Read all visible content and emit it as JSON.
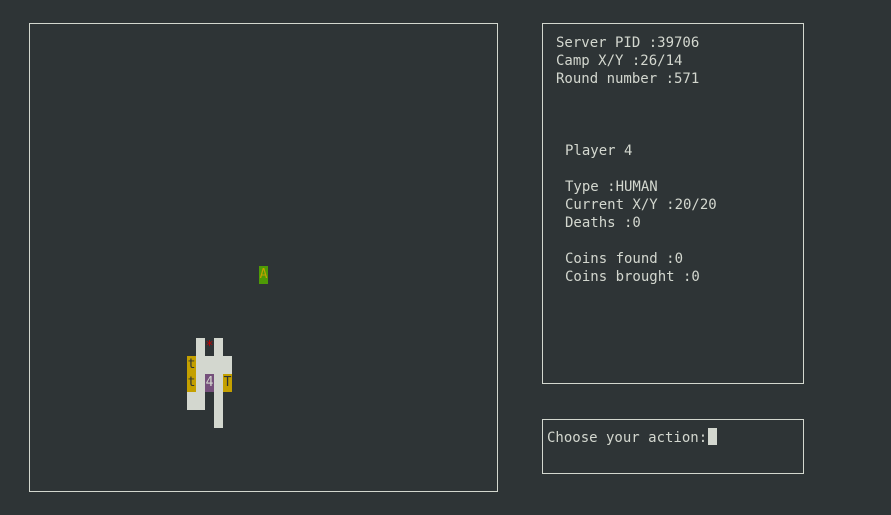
{
  "map": {
    "camp_symbol": "A",
    "player_symbol": "4",
    "beast_symbol": "*",
    "small_treasure_symbol": "t",
    "treasure_symbol": "T"
  },
  "server": {
    "pid_line": "Server PID :39706",
    "camp_line": "Camp X/Y :26/14",
    "round_line": "Round number :571"
  },
  "player": {
    "title": "Player 4",
    "type_line": "Type :HUMAN",
    "position_line": "Current X/Y :20/20",
    "deaths_line": "Deaths :0",
    "coins_found_line": "Coins found :0",
    "coins_brought_line": "Coins brought :0"
  },
  "action": {
    "prompt": "Choose your action:"
  },
  "colors": {
    "background": "#2e3436",
    "foreground": "#d3d7cf",
    "wall": "#d3d7cf",
    "treasure": "#c4a000",
    "camp": "#4e9a06",
    "player": "#75507b",
    "beast": "#cc0000"
  }
}
